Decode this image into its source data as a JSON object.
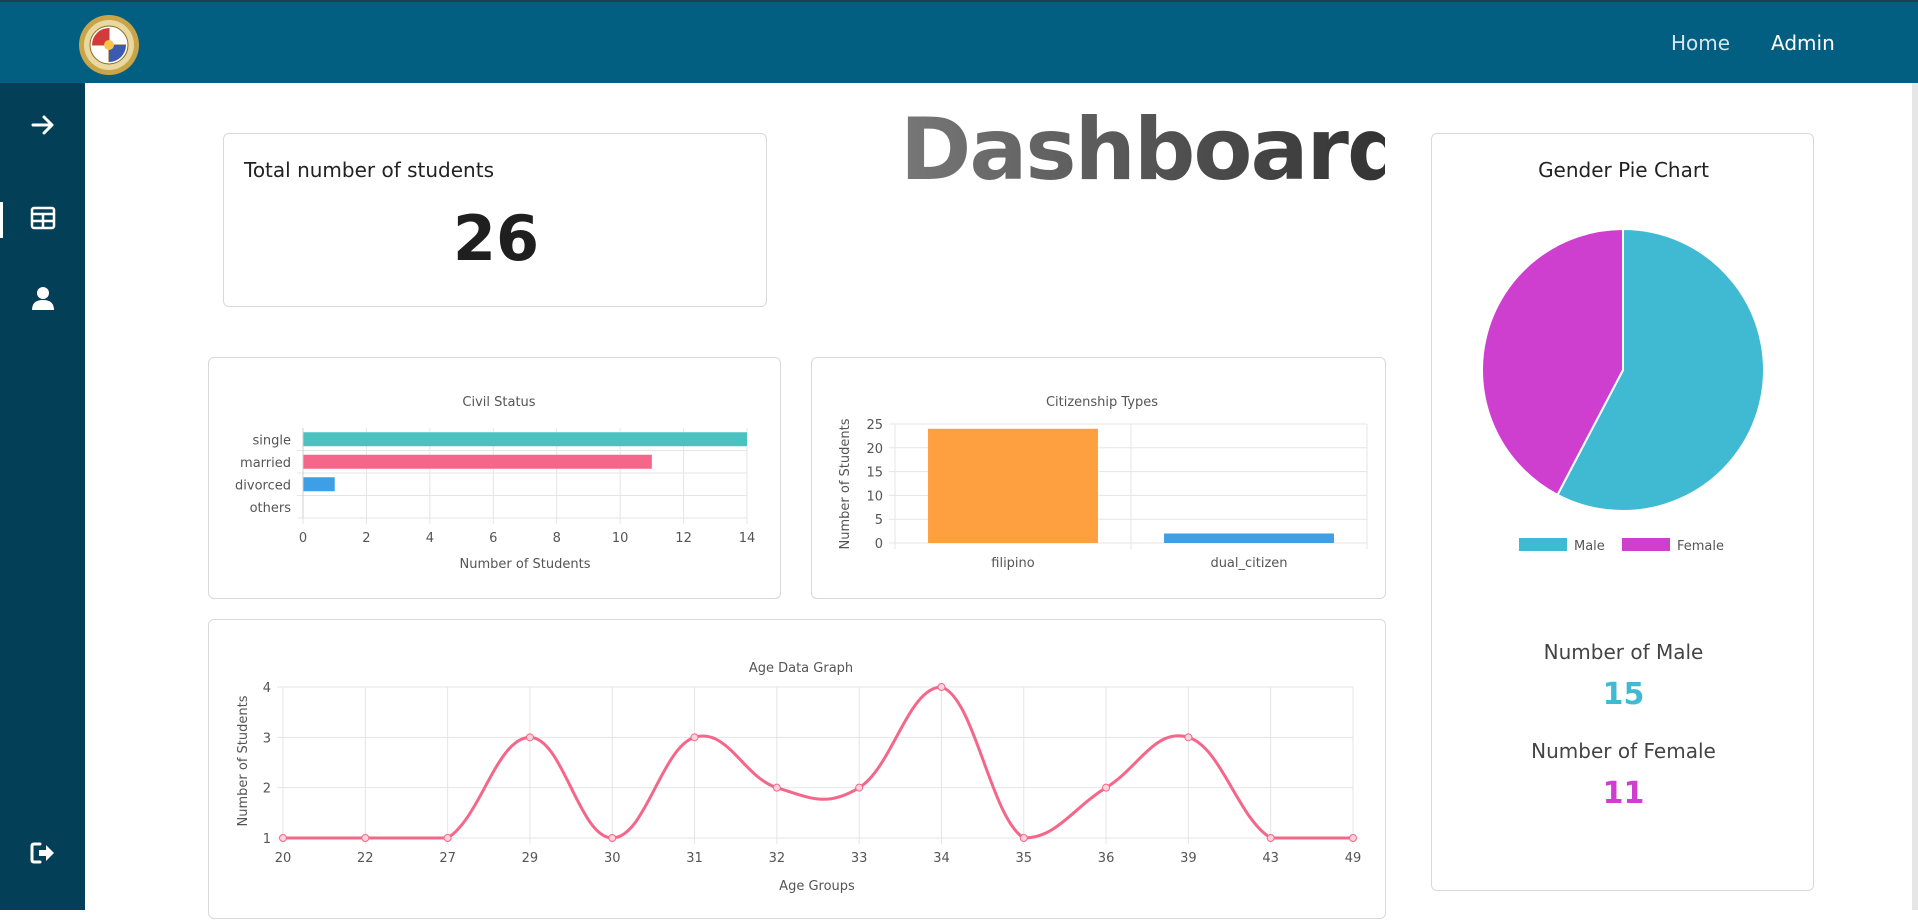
{
  "nav": {
    "home_label": "Home",
    "admin_label": "Admin"
  },
  "sidebar": {
    "items": [
      {
        "icon": "arrow-right-icon"
      },
      {
        "icon": "table-grid-icon",
        "active": true
      },
      {
        "icon": "user-icon"
      },
      {
        "icon": "logout-icon"
      }
    ]
  },
  "page": {
    "title": "Dashboard"
  },
  "total": {
    "label": "Total number of students",
    "value": "26"
  },
  "gender": {
    "title": "Gender Pie Chart",
    "male_label": "Number of Male",
    "male_value": "15",
    "female_label": "Number of Female",
    "female_value": "11"
  },
  "colors": {
    "male": "#40bad2",
    "female": "#cf3fcf",
    "age_line": "#f4678a",
    "civil_single": "#4cc2c0",
    "civil_married": "#f4678a",
    "civil_divorced": "#3e9fe6",
    "cit_filipino": "#fe9f40",
    "cit_dual": "#3e9fe6"
  },
  "chart_data": [
    {
      "type": "bar",
      "title": "Civil Status",
      "orientation": "horizontal",
      "categories": [
        "single",
        "married",
        "divorced",
        "others"
      ],
      "values": [
        14,
        11,
        1,
        0
      ],
      "xlabel": "Number of Students",
      "ylabel": "",
      "xlim": [
        0,
        14
      ],
      "xticks": [
        "0",
        "2",
        "4",
        "6",
        "8",
        "10",
        "12",
        "14"
      ]
    },
    {
      "type": "bar",
      "title": "Citizenship Types",
      "categories": [
        "filipino",
        "dual_citizen"
      ],
      "values": [
        24,
        2
      ],
      "xlabel": "",
      "ylabel": "Number of Students",
      "ylim": [
        0,
        25
      ],
      "yticks": [
        "0",
        "5",
        "10",
        "15",
        "20",
        "25"
      ]
    },
    {
      "type": "line",
      "title": "Age Data Graph",
      "categories": [
        "20",
        "22",
        "27",
        "29",
        "30",
        "31",
        "32",
        "33",
        "34",
        "35",
        "36",
        "39",
        "43",
        "49"
      ],
      "values": [
        1,
        1,
        1,
        3,
        1,
        3,
        2,
        2,
        4,
        1,
        2,
        3,
        1,
        1
      ],
      "xlabel": "Age Groups",
      "ylabel": "Number of Students",
      "ylim": [
        1,
        4
      ],
      "yticks": [
        "1",
        "2",
        "3",
        "4"
      ]
    },
    {
      "type": "pie",
      "title": "",
      "labels": [
        "Male",
        "Female"
      ],
      "values": [
        15,
        11
      ],
      "legend": "bottom"
    }
  ]
}
